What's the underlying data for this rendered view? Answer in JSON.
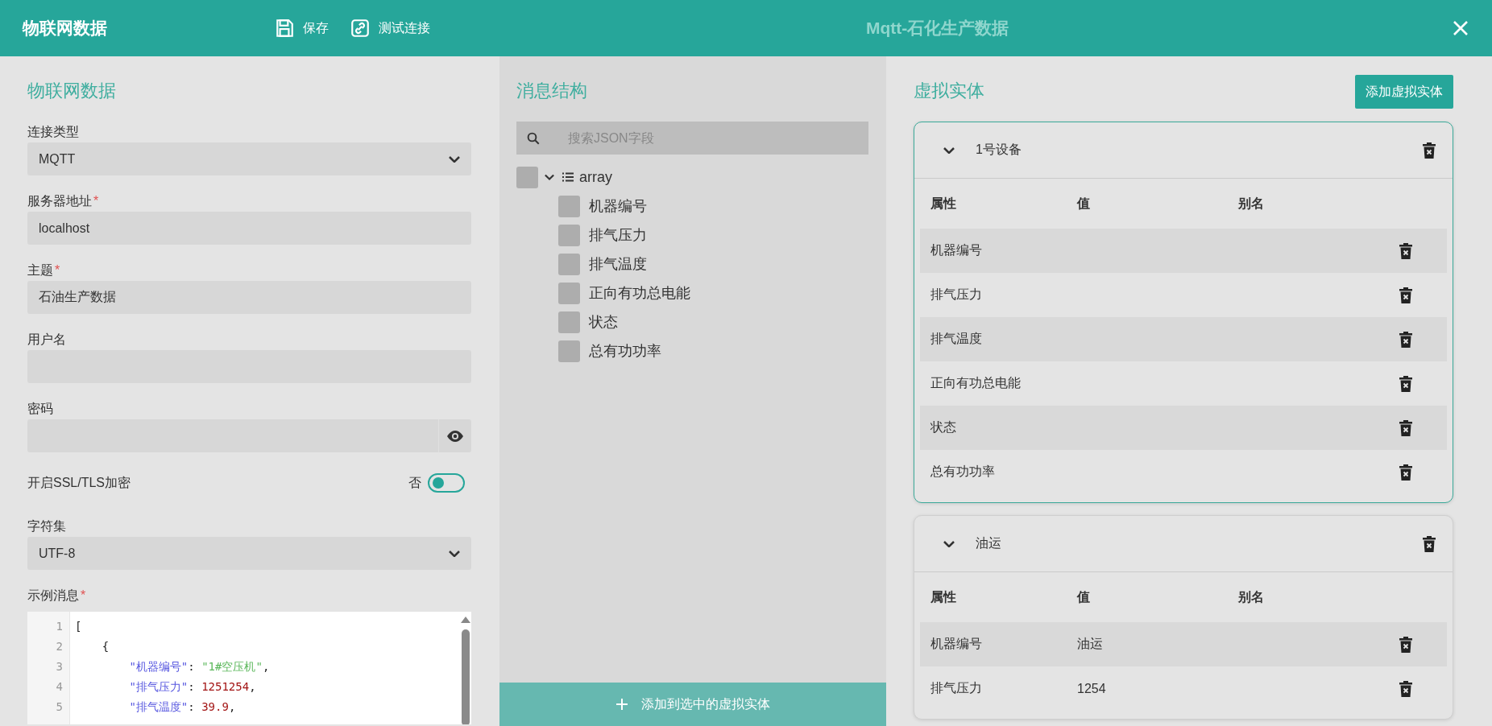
{
  "header": {
    "title": "物联网数据",
    "actions": [
      {
        "kind": "save",
        "label": "保存"
      },
      {
        "kind": "test",
        "label": "测试连接"
      }
    ],
    "center_title": "Mqtt-石化生产数据"
  },
  "connection": {
    "title": "物联网数据",
    "fields": [
      {
        "kind": "select",
        "label": "连接类型",
        "value": "MQTT"
      },
      {
        "kind": "text",
        "label": "服务器地址",
        "required_mark": "*",
        "value": "localhost"
      },
      {
        "kind": "text",
        "label": "主题",
        "required_mark": "*",
        "value": "石油生产数据"
      },
      {
        "kind": "text",
        "label": "用户名"
      },
      {
        "kind": "password",
        "label": "密码"
      },
      {
        "kind": "toggle",
        "label": "开启SSL/TLS加密",
        "state_text": "否",
        "on": false
      },
      {
        "kind": "select",
        "label": "字符集",
        "value": "UTF-8"
      },
      {
        "kind": "code",
        "label": "示例消息",
        "required_mark": "*",
        "lines": [
          {
            "number": "1",
            "tokens": [
              {
                "kind": "punct",
                "text": "["
              }
            ]
          },
          {
            "number": "2",
            "tokens": [
              {
                "kind": "punct",
                "text": "    {"
              }
            ]
          },
          {
            "number": "3",
            "tokens": [
              {
                "kind": "key",
                "text": "        \"机器编号\""
              },
              {
                "kind": "punct",
                "text": ": "
              },
              {
                "kind": "string",
                "text": "\"1#空压机\""
              },
              {
                "kind": "punct",
                "text": ","
              }
            ]
          },
          {
            "number": "4",
            "tokens": [
              {
                "kind": "key",
                "text": "        \"排气压力\""
              },
              {
                "kind": "punct",
                "text": ": "
              },
              {
                "kind": "number",
                "text": "1251254"
              },
              {
                "kind": "punct",
                "text": ","
              }
            ]
          },
          {
            "number": "5",
            "tokens": [
              {
                "kind": "key",
                "text": "        \"排气温度\""
              },
              {
                "kind": "punct",
                "text": ": "
              },
              {
                "kind": "number",
                "text": "39.9"
              },
              {
                "kind": "punct",
                "text": ","
              }
            ]
          }
        ]
      }
    ]
  },
  "message_structure": {
    "title": "消息结构",
    "search": {
      "placeholder": "搜索JSON字段"
    },
    "tree": [
      {
        "label": "array",
        "checked": false,
        "expanded": true,
        "children": [
          {
            "label": "机器编号",
            "checked": false
          },
          {
            "label": "排气压力",
            "checked": false
          },
          {
            "label": "排气温度",
            "checked": false
          },
          {
            "label": "正向有功总电能",
            "checked": false
          },
          {
            "label": "状态",
            "checked": false
          },
          {
            "label": "总有功功率",
            "checked": false
          }
        ]
      }
    ],
    "add_button": "添加到选中的虚拟实体"
  },
  "virtual_entities": {
    "title": "虚拟实体",
    "add_button": "添加虚拟实体",
    "entities": [
      {
        "name": "1号设备",
        "selected": true,
        "expanded": true,
        "columns": [
          "属性",
          "值",
          "别名"
        ],
        "rows": [
          {
            "property": "机器编号"
          },
          {
            "property": "排气压力"
          },
          {
            "property": "排气温度"
          },
          {
            "property": "正向有功总电能"
          },
          {
            "property": "状态"
          },
          {
            "property": "总有功功率"
          }
        ]
      },
      {
        "name": "油运",
        "selected": false,
        "expanded": true,
        "columns": [
          "属性",
          "值",
          "别名"
        ],
        "rows": [
          {
            "property": "机器编号",
            "value": "油运"
          },
          {
            "property": "排气压力",
            "value": "1254"
          }
        ]
      }
    ]
  }
}
